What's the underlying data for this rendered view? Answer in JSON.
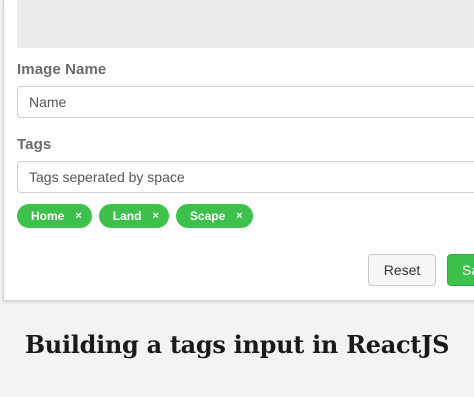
{
  "form": {
    "image_name_label": "Image Name",
    "image_name_placeholder": "Name",
    "tags_label": "Tags",
    "tags_placeholder": "Tags seperated by space",
    "tags": [
      {
        "label": "Home",
        "remove_glyph": "×"
      },
      {
        "label": "Land",
        "remove_glyph": "×"
      },
      {
        "label": "Scape",
        "remove_glyph": "×"
      }
    ],
    "reset_label": "Reset",
    "save_label": "Sa"
  },
  "caption": "Building a tags input in ReactJS",
  "colors": {
    "accent": "#3ec14c",
    "label": "#6b6b6b"
  }
}
